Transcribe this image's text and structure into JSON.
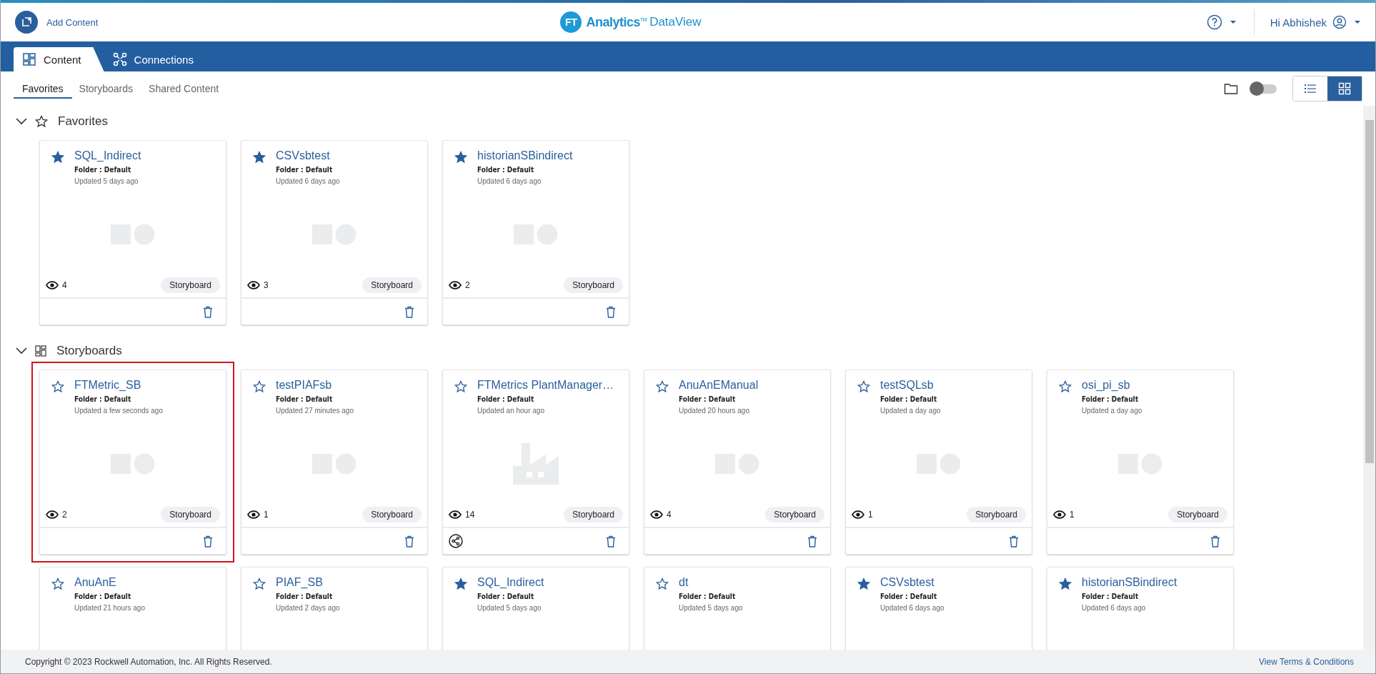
{
  "header": {
    "add_content": "Add Content",
    "logo": {
      "badge": "FT",
      "brand": "Analytics$^{TM}$",
      "product": "DataView"
    },
    "user": "Hi Abhishek"
  },
  "nav_tabs": [
    {
      "label": "Content",
      "kind": "content",
      "selected": true
    },
    {
      "label": "Connections",
      "kind": "connections",
      "selected": false
    }
  ],
  "sub_tabs": [
    {
      "label": "Favorites",
      "selected": true
    },
    {
      "label": "Storyboards",
      "selected": false
    },
    {
      "label": "Shared Content",
      "selected": false
    }
  ],
  "toolbar": {
    "folder_toggle_on": false,
    "views": [
      {
        "kind": "list",
        "selected": false
      },
      {
        "kind": "grid",
        "selected": true
      }
    ]
  },
  "sections": [
    {
      "title": "Favorites",
      "kind": "favorites",
      "expanded": true,
      "cards": [
        {
          "title": "SQL_Indirect",
          "starred": true,
          "folder": "Folder : Default",
          "updated": "Updated 5 days ago",
          "thumbnail": {
            "kind": "shapes"
          },
          "views": "4",
          "type": "Storyboard",
          "shared": false,
          "selected": false
        },
        {
          "title": "CSVsbtest",
          "starred": true,
          "folder": "Folder : Default",
          "updated": "Updated 6 days ago",
          "thumbnail": {
            "kind": "shapes"
          },
          "views": "3",
          "type": "Storyboard",
          "shared": false,
          "selected": false
        },
        {
          "title": "historianSBindirect",
          "starred": true,
          "folder": "Folder : Default",
          "updated": "Updated 6 days ago",
          "thumbnail": {
            "kind": "shapes"
          },
          "views": "2",
          "type": "Storyboard",
          "shared": false,
          "selected": false
        }
      ]
    },
    {
      "title": "Storyboards",
      "kind": "storyboards",
      "expanded": true,
      "cards": [
        {
          "title": "FTMetric_SB",
          "starred": false,
          "folder": "Folder : Default",
          "updated": "Updated a few seconds ago",
          "thumbnail": {
            "kind": "shapes"
          },
          "views": "2",
          "type": "Storyboard",
          "shared": false,
          "selected": true
        },
        {
          "title": "testPIAFsb",
          "starred": false,
          "folder": "Folder : Default",
          "updated": "Updated 27 minutes ago",
          "thumbnail": {
            "kind": "shapes"
          },
          "views": "1",
          "type": "Storyboard",
          "shared": false,
          "selected": false
        },
        {
          "title": "FTMetrics PlantManager…",
          "starred": false,
          "folder": "Folder : Default",
          "updated": "Updated an hour ago",
          "thumbnail": {
            "kind": "factory"
          },
          "views": "14",
          "type": "Storyboard",
          "shared": true,
          "selected": false
        },
        {
          "title": "AnuAnEManual",
          "starred": false,
          "folder": "Folder : Default",
          "updated": "Updated 20 hours ago",
          "thumbnail": {
            "kind": "shapes"
          },
          "views": "4",
          "type": "Storyboard",
          "shared": false,
          "selected": false
        },
        {
          "title": "testSQLsb",
          "starred": false,
          "folder": "Folder : Default",
          "updated": "Updated a day ago",
          "thumbnail": {
            "kind": "shapes"
          },
          "views": "1",
          "type": "Storyboard",
          "shared": false,
          "selected": false
        },
        {
          "title": "osi_pi_sb",
          "starred": false,
          "folder": "Folder : Default",
          "updated": "Updated a day ago",
          "thumbnail": {
            "kind": "shapes"
          },
          "views": "1",
          "type": "Storyboard",
          "shared": false,
          "selected": false
        },
        {
          "title": "AnuAnE",
          "starred": false,
          "folder": "Folder : Default",
          "updated": "Updated 21 hours ago",
          "selected": false
        },
        {
          "title": "PIAF_SB",
          "starred": false,
          "folder": "Folder : Default",
          "updated": "Updated 2 days ago",
          "selected": false
        },
        {
          "title": "SQL_Indirect",
          "starred": true,
          "folder": "Folder : Default",
          "updated": "Updated 5 days ago",
          "selected": false
        },
        {
          "title": "dt",
          "starred": false,
          "folder": "Folder : Default",
          "updated": "Updated 5 days ago",
          "selected": false
        },
        {
          "title": "CSVsbtest",
          "starred": true,
          "folder": "Folder : Default",
          "updated": "Updated 6 days ago",
          "selected": false
        },
        {
          "title": "historianSBindirect",
          "starred": true,
          "folder": "Folder : Default",
          "updated": "Updated 6 days ago",
          "selected": false
        }
      ]
    }
  ],
  "footer": {
    "copyright": "Copyright © 2023 Rockwell Automation, Inc. All Rights Reserved.",
    "terms": "View Terms & Conditions"
  }
}
